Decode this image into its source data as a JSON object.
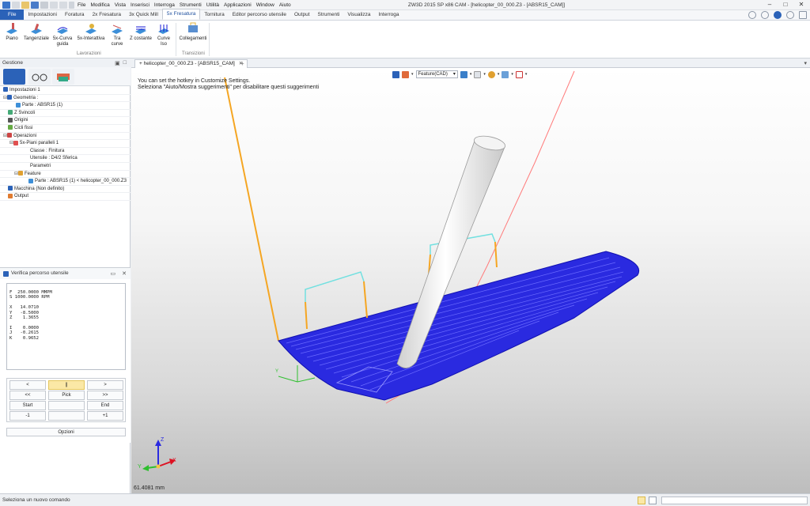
{
  "menubar": {
    "items": [
      "File",
      "Modifica",
      "Vista",
      "Inserisci",
      "Interroga",
      "Strumenti",
      "Utilità",
      "Applicazioni",
      "Window",
      "Aiuto"
    ]
  },
  "window": {
    "title": "ZW3D 2015 SP x86        CAM - [helicopter_00_000.Z3 - [ABSR15_CAM]]"
  },
  "ribbon": {
    "tabs": [
      "File",
      "Impostazioni",
      "Foratura",
      "2x Fresatura",
      "3x Quick Mill",
      "5x Fresatura",
      "Tornitura",
      "Editor percorso utensile",
      "Output",
      "Strumenti",
      "Visualizza",
      "Interroga"
    ],
    "active_tab": "5x Fresatura",
    "buttons": [
      "Piano",
      "Tangenziale",
      "5x-Curva guida",
      "5x-Interattiva",
      "Tra curve",
      "Z costante",
      "Curve Iso",
      "Collegamenti"
    ],
    "groups": [
      "Lavorazioni",
      "Transizioni"
    ]
  },
  "left_panel": {
    "title": "Gestione",
    "tree": [
      {
        "label": "Impostazioni 1"
      },
      {
        "label": "Geometria :"
      },
      {
        "label": "Parte : ABSR15 (1)"
      },
      {
        "label": "Z Svincoli"
      },
      {
        "label": "Origini"
      },
      {
        "label": "Cicli fissi"
      },
      {
        "label": "Operazioni"
      },
      {
        "label": "5x-Piani paralleli 1"
      },
      {
        "label": "Classe : Finitura"
      },
      {
        "label": "Utensile : D4/2 Sferica"
      },
      {
        "label": "Parametri"
      },
      {
        "label": "Feature"
      },
      {
        "label": "Parte : ABSR15 (1) < helicopter_00_000.Z3"
      },
      {
        "label": "Macchina (Non definito)"
      },
      {
        "label": "Output"
      }
    ]
  },
  "verify": {
    "title": "Verifica percorso utensile",
    "readout": "F  250.0000 MMPM\nS 1000.0000 RPM\n\nX   14.0710\nY   -8.5000\nZ    1.3655\n\nI    0.0000\nJ   -0.2615\nK    0.9652",
    "buttons": {
      "prev": "<",
      "pause": "||",
      "next": ">",
      "rewind": "<<",
      "pick": "Pick",
      "forward": ">>",
      "start": "Start",
      "end": "End",
      "minus_one": "-1",
      "plus_one": "+1"
    },
    "options_label": "Opzioni"
  },
  "document": {
    "tab_label": "helicopter_00_000.Z3 - [ABSR15_CAM]",
    "close": "✕",
    "add": "+"
  },
  "viewport": {
    "hint_line1": "You can set the hotkey in Customize Settings.",
    "hint_line2": "Seleziona \"Aiuto/Mostra suggerimenti\" per disabilitare questi suggerimenti",
    "feature_filter": "Feature(CAD)",
    "dimension": "61.4081 mm",
    "axis_labels": {
      "x": "X",
      "y": "Y",
      "z": "Z"
    },
    "colors": {
      "toolpath": "#1a1ad6",
      "tool": "#f2f2f2",
      "lead": "#f5a623",
      "rapid": "#ff7b7b",
      "link": "#72e0e0"
    }
  },
  "status": {
    "text": "Seleziona un nuovo comando"
  }
}
